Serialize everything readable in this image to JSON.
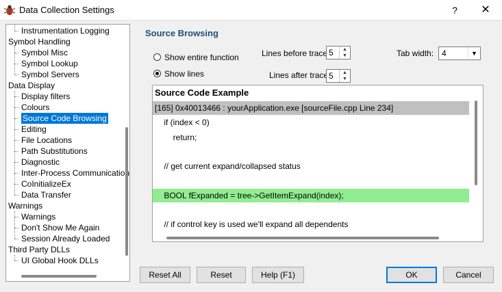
{
  "window": {
    "title": "Data Collection Settings",
    "help_label": "?",
    "close_label": "✕"
  },
  "tree": {
    "items": [
      {
        "label": "Instrumentation Logging",
        "level": 1
      },
      {
        "label": "Symbol Handling",
        "level": 0
      },
      {
        "label": "Symbol Misc",
        "level": 1
      },
      {
        "label": "Symbol Lookup",
        "level": 1
      },
      {
        "label": "Symbol Servers",
        "level": 1
      },
      {
        "label": "Data Display",
        "level": 0
      },
      {
        "label": "Display filters",
        "level": 1
      },
      {
        "label": "Colours",
        "level": 1
      },
      {
        "label": "Source Code Browsing",
        "level": 1,
        "selected": true
      },
      {
        "label": "Editing",
        "level": 1
      },
      {
        "label": "File Locations",
        "level": 1
      },
      {
        "label": "Path Substitutions",
        "level": 1
      },
      {
        "label": "Diagnostic",
        "level": 1
      },
      {
        "label": "Inter-Process Communication",
        "level": 1
      },
      {
        "label": "CoInitializeEx",
        "level": 1
      },
      {
        "label": "Data Transfer",
        "level": 1
      },
      {
        "label": "Warnings",
        "level": 0
      },
      {
        "label": "Warnings",
        "level": 1
      },
      {
        "label": "Don't Show Me Again",
        "level": 1
      },
      {
        "label": "Session Already Loaded",
        "level": 1
      },
      {
        "label": "Third Party DLLs",
        "level": 0
      },
      {
        "label": "UI Global Hook DLLs",
        "level": 1
      }
    ]
  },
  "panel": {
    "section_title": "Source Browsing",
    "radio_entire_function": "Show entire function",
    "radio_show_lines": "Show lines",
    "selected_radio": "show_lines",
    "lines_before_label": "Lines before trace",
    "lines_before_value": "5",
    "lines_after_label": "Lines after trace",
    "lines_after_value": "5",
    "tab_width_label": "Tab width:",
    "tab_width_value": "4"
  },
  "code_example": {
    "header": "Source Code Example",
    "lines": [
      {
        "text": "[165] 0x40013466 : yourApplication.exe [sourceFile.cpp Line 234]",
        "style": "gray"
      },
      {
        "text": "    if (index < 0)",
        "style": "normal"
      },
      {
        "text": "        return;",
        "style": "normal"
      },
      {
        "text": "",
        "style": "normal"
      },
      {
        "text": "    // get current expand/collapsed status",
        "style": "normal"
      },
      {
        "text": "",
        "style": "normal"
      },
      {
        "text": "    BOOL fExpanded = tree->GetItemExpand(index);",
        "style": "green"
      },
      {
        "text": "",
        "style": "normal"
      },
      {
        "text": "    // if control key is used we'll expand all dependents",
        "style": "normal"
      }
    ]
  },
  "buttons": {
    "reset_all": "Reset All",
    "reset": "Reset",
    "help": "Help (F1)",
    "ok": "OK",
    "cancel": "Cancel"
  }
}
